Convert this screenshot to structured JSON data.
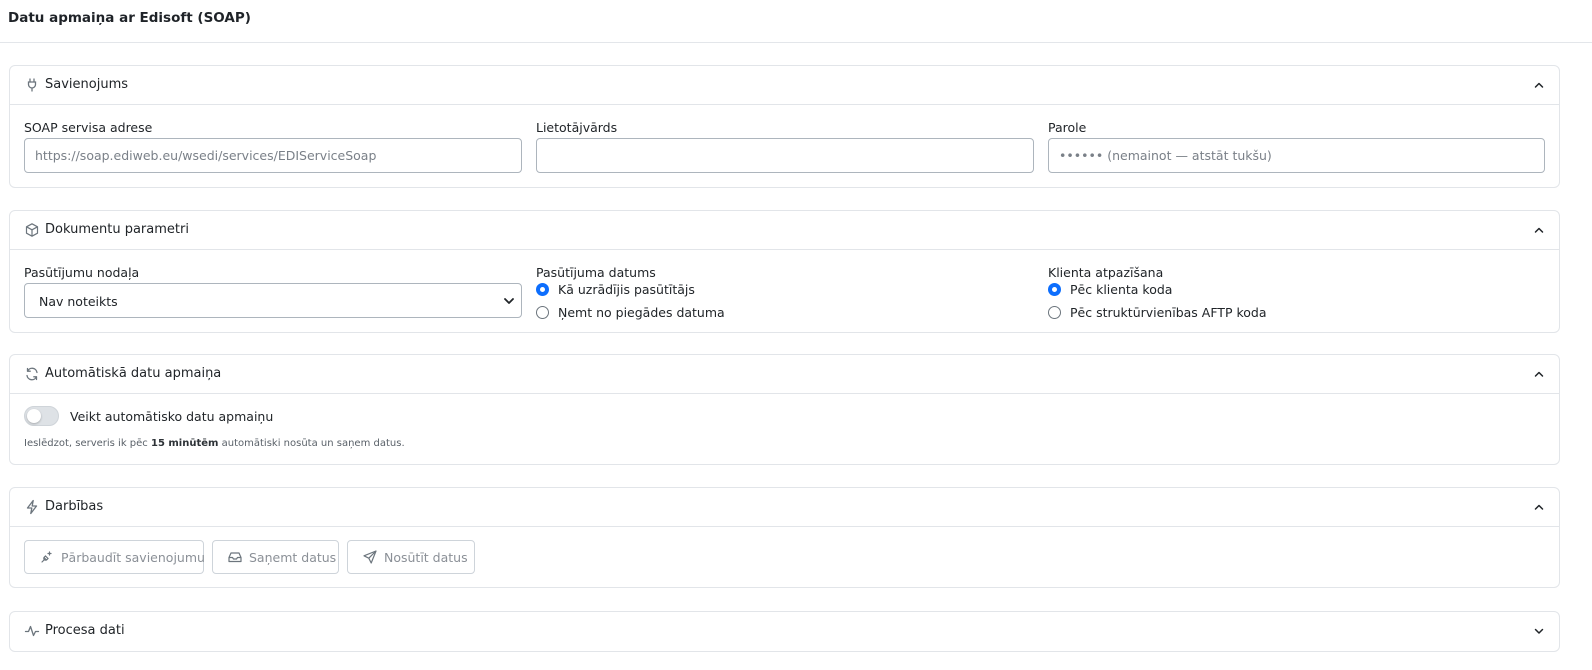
{
  "page": {
    "title": "Datu apmaiņa ar Edisoft (SOAP)"
  },
  "connection": {
    "title": "Savienojums",
    "icon": "plug-icon",
    "soap_label": "SOAP servisa adrese",
    "soap_placeholder": "https://soap.ediweb.eu/wsedi/services/EDIServiceSoap",
    "soap_value": "",
    "username_label": "Lietotājvārds",
    "username_value": "",
    "password_label": "Parole",
    "password_placeholder": "•••••• (nemainot — atstāt tukšu)",
    "password_value": ""
  },
  "documents": {
    "title": "Dokumentu parametri",
    "icon": "box-icon",
    "department_label": "Pasūtījumu nodaļa",
    "department_selected": "Nav noteikts",
    "order_date_label": "Pasūtījuma datums",
    "order_date_options": [
      "Kā uzrādījis pasūtītājs",
      "Ņemt no piegādes datuma"
    ],
    "order_date_selected_index": 0,
    "client_label": "Klienta atpazīšana",
    "client_options": [
      "Pēc klienta koda",
      "Pēc struktūrvienības AFTP koda"
    ],
    "client_selected_index": 0
  },
  "auto": {
    "title": "Automātiskā datu apmaiņa",
    "icon": "refresh-icon",
    "toggle_label": "Veikt automātisko datu apmaiņu",
    "toggle_on": false,
    "helper_prefix": "Ieslēdzot, serveris ik pēc ",
    "helper_bold": "15 minūtēm",
    "helper_suffix": " automātiski nosūta un saņem datus."
  },
  "actions": {
    "title": "Darbības",
    "icon": "lightning-icon",
    "buttons": [
      {
        "label": "Pārbaudīt savienojumu",
        "icon": "plug-test-icon"
      },
      {
        "label": "Saņemt datus",
        "icon": "inbox-icon"
      },
      {
        "label": "Nosūtīt datus",
        "icon": "send-icon"
      }
    ]
  },
  "process": {
    "title": "Procesa dati",
    "icon": "activity-icon"
  },
  "colors": {
    "accent": "#0d6efd",
    "border": "#e2e5e9",
    "muted_text": "#8b9097"
  }
}
